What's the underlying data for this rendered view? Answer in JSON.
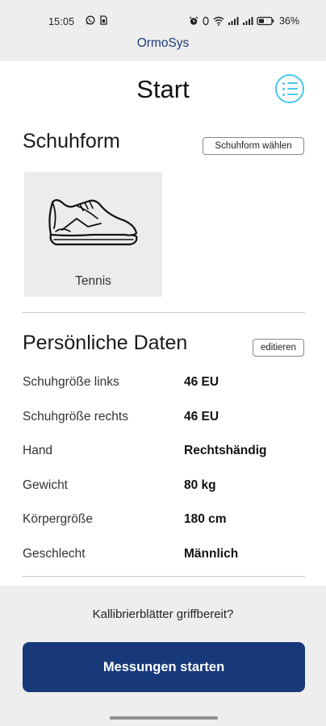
{
  "status_bar": {
    "time": "15:05",
    "battery": "36%",
    "left_icons": [
      "whatsapp-icon",
      "sim-card-icon"
    ],
    "right_icons": [
      "alarm-icon",
      "bluetooth-icon",
      "wifi-icon",
      "signal-icon",
      "signal-icon-2",
      "battery-icon"
    ]
  },
  "app": {
    "name": "OrmoSys"
  },
  "page": {
    "title": "Start"
  },
  "shoe_form": {
    "title": "Schuhform",
    "select_button": "Schuhform wählen",
    "selected": {
      "label": "Tennis",
      "icon": "sneaker-icon"
    }
  },
  "personal_data": {
    "title": "Persönliche Daten",
    "edit_button": "editieren",
    "rows": [
      {
        "label": "Schuhgröße links",
        "value": "46 EU"
      },
      {
        "label": "Schuhgröße rechts",
        "value": "46 EU"
      },
      {
        "label": "Hand",
        "value": "Rechtshändig"
      },
      {
        "label": "Gewicht",
        "value": "80 kg"
      },
      {
        "label": "Körpergröße",
        "value": "180 cm"
      },
      {
        "label": "Geschlecht",
        "value": "Männlich"
      }
    ]
  },
  "footer": {
    "question": "Kallibrierblätter griffbereit?",
    "start_button": "Messungen starten"
  },
  "colors": {
    "accent": "#47c7ee",
    "primary": "#17397a",
    "brand_text": "#1d3b7a",
    "panel_bg": "#eeeeee",
    "card_bg": "#ececec"
  }
}
